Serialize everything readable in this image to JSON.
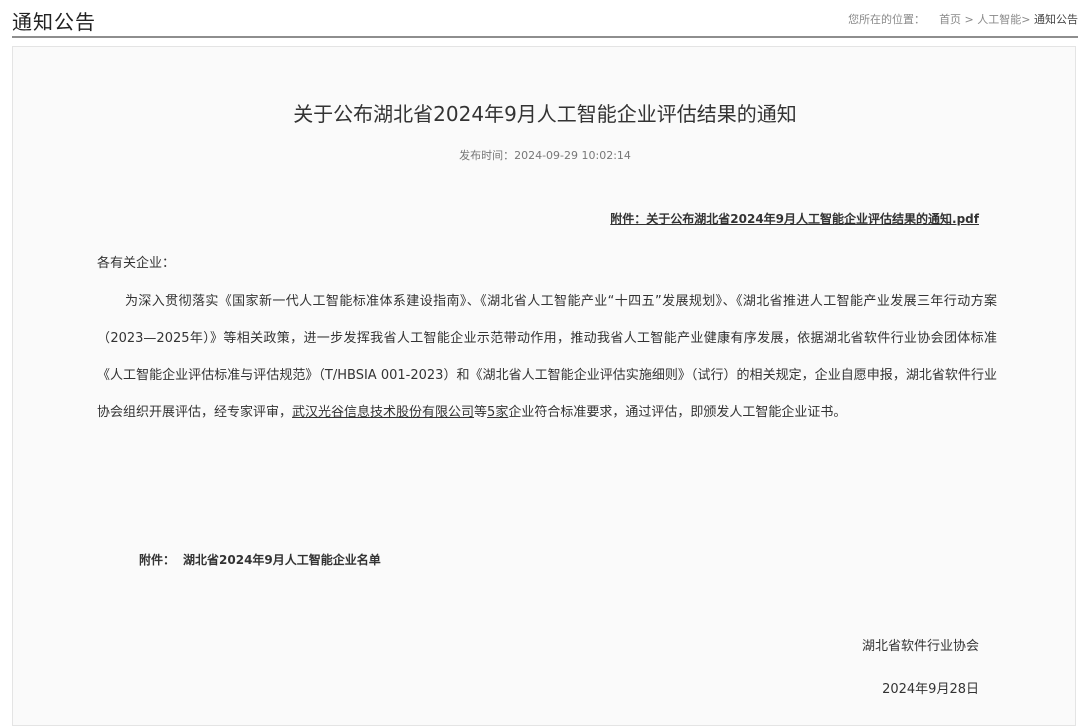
{
  "header": {
    "title": "通知公告",
    "location_prefix": "您所在的位置：",
    "breadcrumb": [
      {
        "label": "首页"
      },
      {
        "label": "人工智能"
      },
      {
        "label": "通知公告"
      }
    ],
    "separators": [
      " > ",
      "> "
    ]
  },
  "article": {
    "title": "关于公布湖北省2024年9月人工智能企业评估结果的通知",
    "publish_label": "发布时间：",
    "publish_time": "2024-09-29 10:02:14",
    "attachment_link": "附件：关于公布湖北省2024年9月人工智能企业评估结果的通知.pdf",
    "salutation": "各有关企业：",
    "body_part1": "为深入贯彻落实《国家新一代人工智能标准体系建设指南》、《湖北省人工智能产业“十四五”发展规划》、《湖北省推进人工智能产业发展三年行动方案（2023—2025年）》等相关政策，进一步发挥我省人工智能企业示范带动作用，推动我省人工智能产业健康有序发展，依据湖北省软件行业协会团体标准《人工智能企业评估标准与评估规范》（T/HBSIA 001-2023）和《湖北省人工智能企业评估实施细则》（试行）的相关规定，企业自愿申报，湖北省软件行业协会组织开展评估，经专家评审，",
    "company_link": "武汉光谷信息技术股份有限公司",
    "body_part2": "等",
    "count_link": "5家",
    "body_part3": "企业符合标准要求，通过评估，即颁发人工智能企业证书。",
    "annex_label": "附件：",
    "annex_name": "湖北省2024年9月人工智能企业名单",
    "signature": "湖北省软件行业协会",
    "sign_date": "2024年9月28日"
  }
}
